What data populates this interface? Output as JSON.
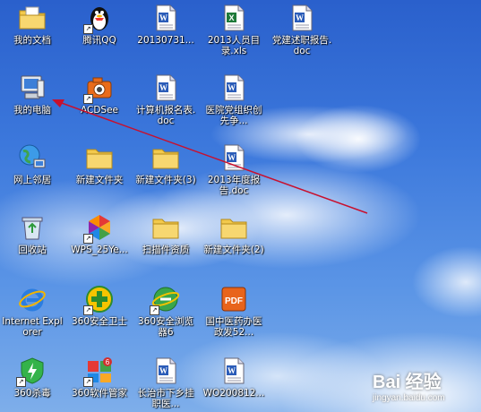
{
  "desktop": {
    "icons": [
      {
        "label": "我的文档",
        "icon": "my-documents-folder-icon"
      },
      {
        "label": "腾讯QQ",
        "icon": "qq-penguin-icon"
      },
      {
        "label": "20130731...",
        "icon": "word-document-icon"
      },
      {
        "label": "2013人员目录.xls",
        "icon": "excel-document-icon"
      },
      {
        "label": "党建述职报告.doc",
        "icon": "word-document-icon"
      },
      {
        "label": "我的电脑",
        "icon": "my-computer-icon"
      },
      {
        "label": "ACDSee",
        "icon": "acdsee-camera-icon"
      },
      {
        "label": "计算机报名表.doc",
        "icon": "word-document-icon"
      },
      {
        "label": "医院党组织创先争...",
        "icon": "word-document-icon"
      },
      {
        "label": "网上邻居",
        "icon": "network-places-icon"
      },
      {
        "label": "新建文件夹",
        "icon": "folder-icon"
      },
      {
        "label": "新建文件夹(3)",
        "icon": "folder-icon"
      },
      {
        "label": "2013年度报告.doc",
        "icon": "word-document-icon"
      },
      {
        "label": "回收站",
        "icon": "recycle-bin-icon"
      },
      {
        "label": "WPS_25Ye...",
        "icon": "wps-office-icon"
      },
      {
        "label": "扫描件资质",
        "icon": "folder-icon"
      },
      {
        "label": "新建文件夹(2)",
        "icon": "folder-icon"
      },
      {
        "label": "Internet Explorer",
        "icon": "internet-explorer-icon"
      },
      {
        "label": "360安全卫士",
        "icon": "360-safeguard-icon"
      },
      {
        "label": "360安全浏览器6",
        "icon": "360-browser-icon"
      },
      {
        "label": "国中医药办医政发52...",
        "icon": "pdf-document-icon"
      },
      {
        "label": "360杀毒",
        "icon": "360-antivirus-icon"
      },
      {
        "label": "360软件管家",
        "icon": "360-software-manager-icon"
      },
      {
        "label": "长治市下乡挂职医...",
        "icon": "word-document-icon"
      },
      {
        "label": "WO200812...",
        "icon": "word-document-icon"
      }
    ]
  },
  "watermark": {
    "logo": "Bai 经验",
    "url": "jingyan.baidu.com"
  },
  "colors": {
    "arrow": "#c8102e",
    "folder": "#f2c94c",
    "word": "#2b5cb8",
    "excel": "#1f7a3a"
  }
}
